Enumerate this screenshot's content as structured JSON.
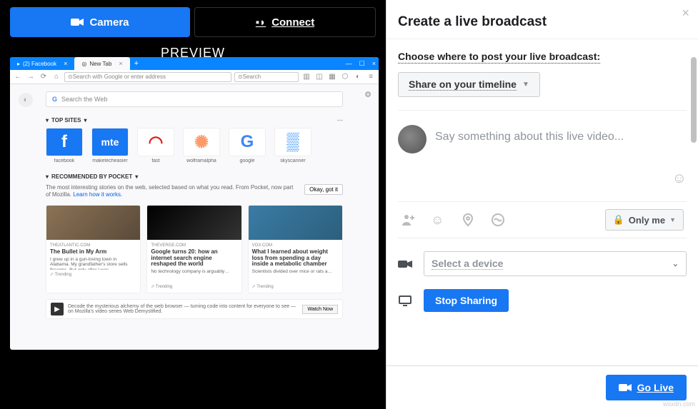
{
  "left": {
    "tabs": {
      "camera": "Camera",
      "connect": "Connect"
    },
    "preview": "PREVIEW"
  },
  "browser": {
    "tabs": [
      {
        "label": "(2) Facebook"
      },
      {
        "label": "New Tab"
      }
    ],
    "address_placeholder": "Search with Google or enter address",
    "search_placeholder": "Search",
    "search_web": "Search the Web",
    "top_sites_header": "TOP SITES",
    "sites": [
      {
        "label": "facebook",
        "letter": "f",
        "bg": "#1877f2",
        "fg": "#fff"
      },
      {
        "label": "maketecheasier",
        "letter": "mte",
        "bg": "#1877f2",
        "fg": "#fff"
      },
      {
        "label": "fast",
        "letter": "◠",
        "bg": "#fff",
        "fg": "#e02020"
      },
      {
        "label": "wolframalpha",
        "letter": "✺",
        "bg": "#fff",
        "fg": "#f96"
      },
      {
        "label": "google",
        "letter": "G",
        "bg": "#fff",
        "fg": "#4285f4"
      },
      {
        "label": "skyscanner",
        "letter": "▒",
        "bg": "#fff",
        "fg": "#07f"
      }
    ],
    "pocket_header": "RECOMMENDED BY POCKET",
    "pocket_desc": "The most interesting stories on the web, selected based on what you read. From Pocket, now part of Mozilla.",
    "pocket_link": "Learn how it works.",
    "pocket_btn": "Okay, got it",
    "cards": [
      {
        "src": "THEATLANTIC.COM",
        "title": "The Bullet in My Arm",
        "desc": "I grew up in a gun-loving town in Alabama. My grandfather's store sells firearms. But only after I was…",
        "trend": "Trending",
        "img": "linear-gradient(135deg,#8b7355,#5a4a3a)"
      },
      {
        "src": "THEVERGE.COM",
        "title": "Google turns 20: how an internet search engine reshaped the world",
        "desc": "No technology company is arguably…",
        "trend": "Trending",
        "img": "linear-gradient(135deg,#000,#333),radial-gradient(circle at 30% 50%,#f4b400 0%,transparent 25%),radial-gradient(circle at 50% 50%,#ea4335 0%,transparent 25%),radial-gradient(circle at 70% 50%,#4285f4 0%,transparent 25%)"
      },
      {
        "src": "VOX.COM",
        "title": "What I learned about weight loss from spending a day inside a metabolic chamber",
        "desc": "Scientists divided over mice or rats a…",
        "trend": "Trending",
        "img": "linear-gradient(135deg,#3a7ca5,#2c5f7c)"
      }
    ],
    "snippet_text": "Decode the mysterious alchemy of the web browser — turning code into content for everyone to see — on Mozilla's video series Web Demystified.",
    "watch_now": "Watch Now"
  },
  "right": {
    "title": "Create a live broadcast",
    "choose_label": "Choose where to post your live broadcast:",
    "share_timeline": "Share on your timeline",
    "composer_placeholder": "Say something about this live video...",
    "privacy": "Only me",
    "select_device": "Select a device",
    "stop_sharing": "Stop Sharing",
    "go_live": "Go Live"
  },
  "watermark": "wsxdn.com"
}
